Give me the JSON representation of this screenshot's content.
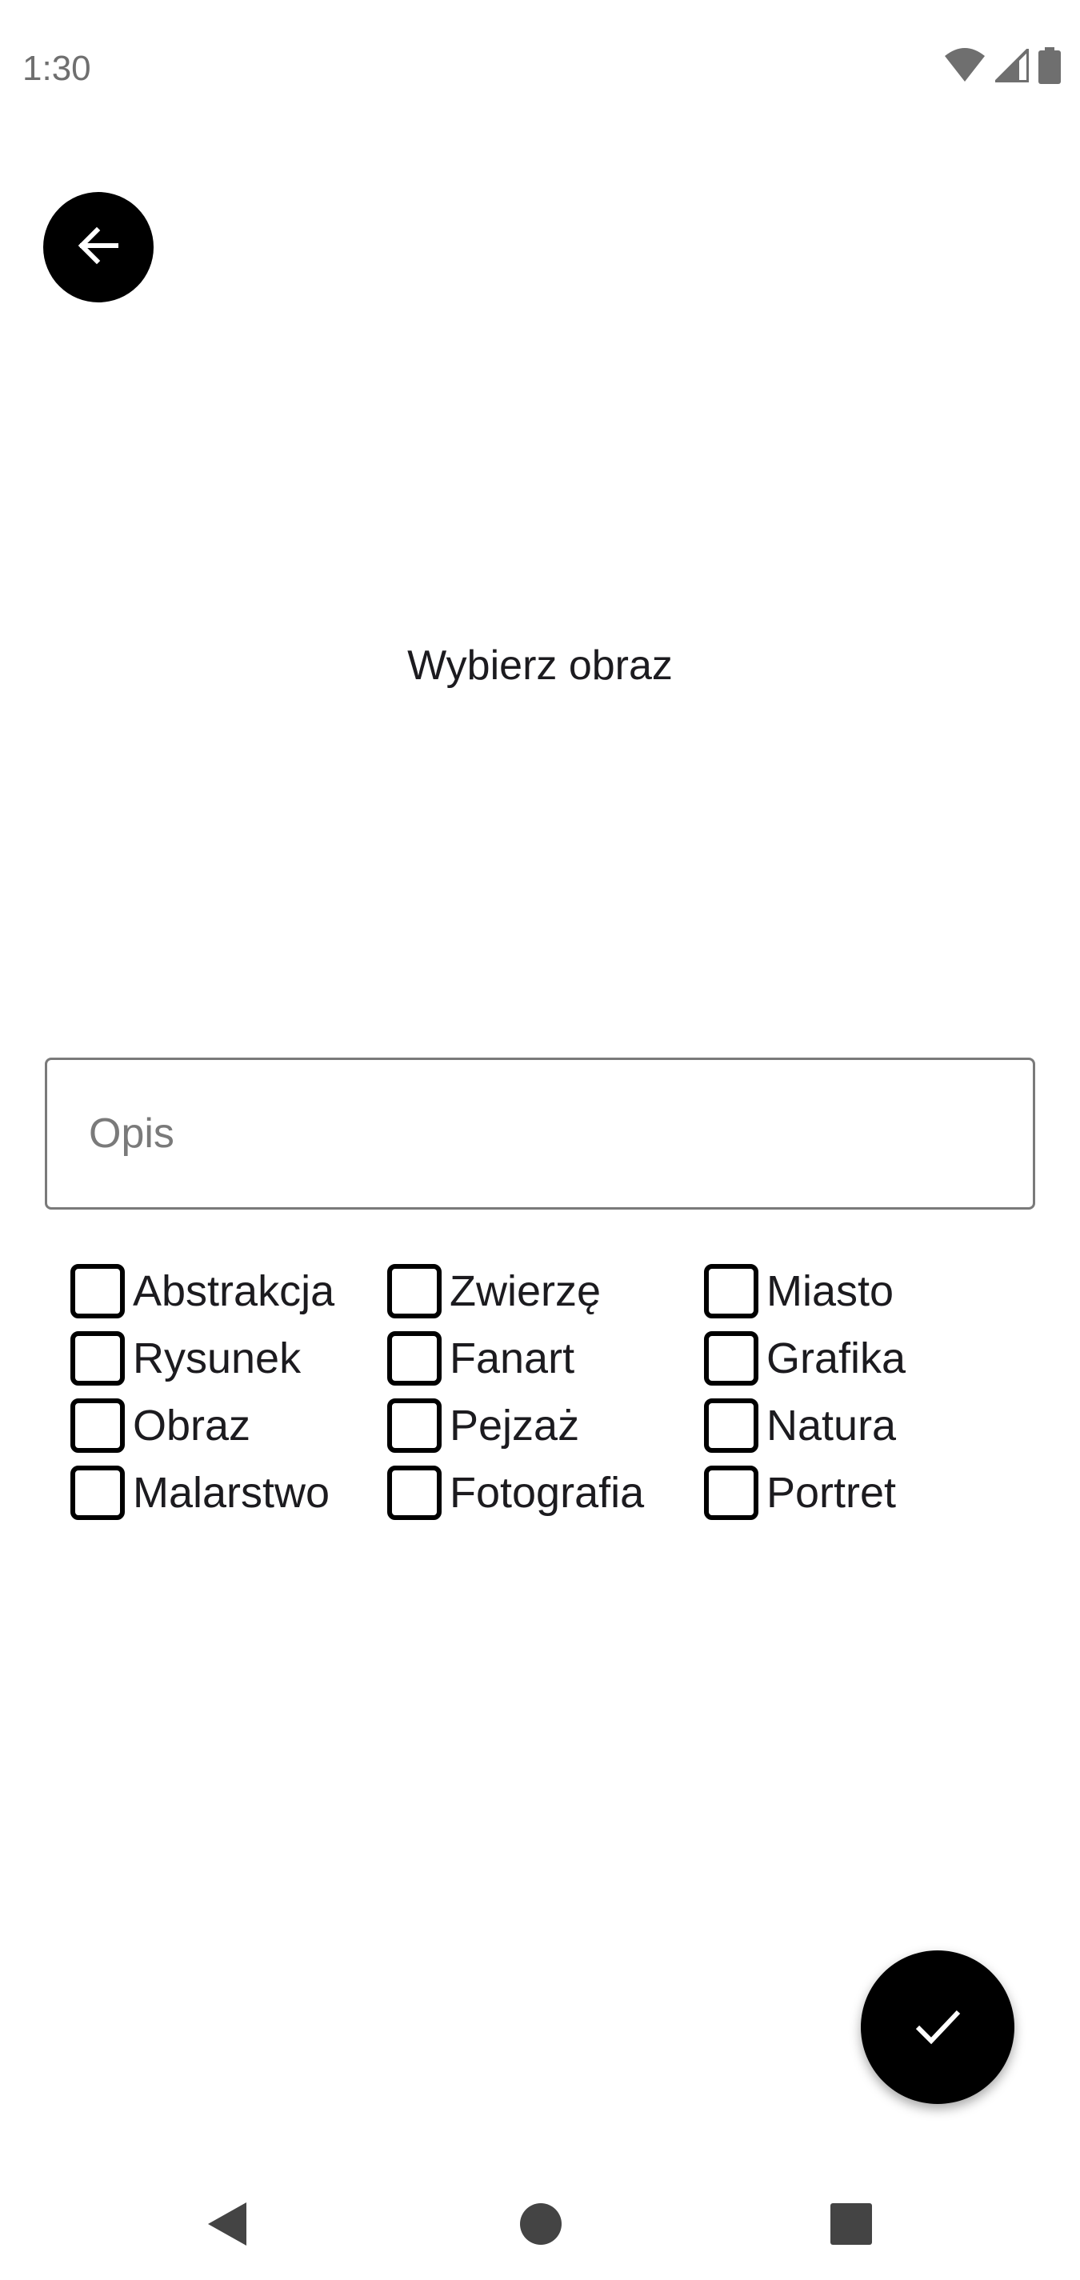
{
  "status_bar": {
    "time": "1:30",
    "icons": [
      "wifi-icon",
      "cell-signal-icon",
      "battery-icon"
    ]
  },
  "toolbar": {
    "back_icon": "arrow-back-icon"
  },
  "image_picker": {
    "label": "Wybierz obraz"
  },
  "description": {
    "placeholder": "Opis",
    "value": ""
  },
  "categories": [
    {
      "label": "Abstrakcja",
      "checked": false
    },
    {
      "label": "Zwierzę",
      "checked": false
    },
    {
      "label": "Miasto",
      "checked": false
    },
    {
      "label": "Rysunek",
      "checked": false
    },
    {
      "label": "Fanart",
      "checked": false
    },
    {
      "label": "Grafika",
      "checked": false
    },
    {
      "label": "Obraz",
      "checked": false
    },
    {
      "label": "Pejzaż",
      "checked": false
    },
    {
      "label": "Natura",
      "checked": false
    },
    {
      "label": "Malarstwo",
      "checked": false
    },
    {
      "label": "Fotografia",
      "checked": false
    },
    {
      "label": "Portret",
      "checked": false
    }
  ],
  "confirm": {
    "icon": "check-icon"
  },
  "nav_bar": {
    "icons": [
      "nav-back-icon",
      "nav-home-icon",
      "nav-recents-icon"
    ]
  },
  "colors": {
    "background": "#ffffff",
    "button": "#000000",
    "outline": "#7a7a7a",
    "text": "#1c1b1f"
  }
}
